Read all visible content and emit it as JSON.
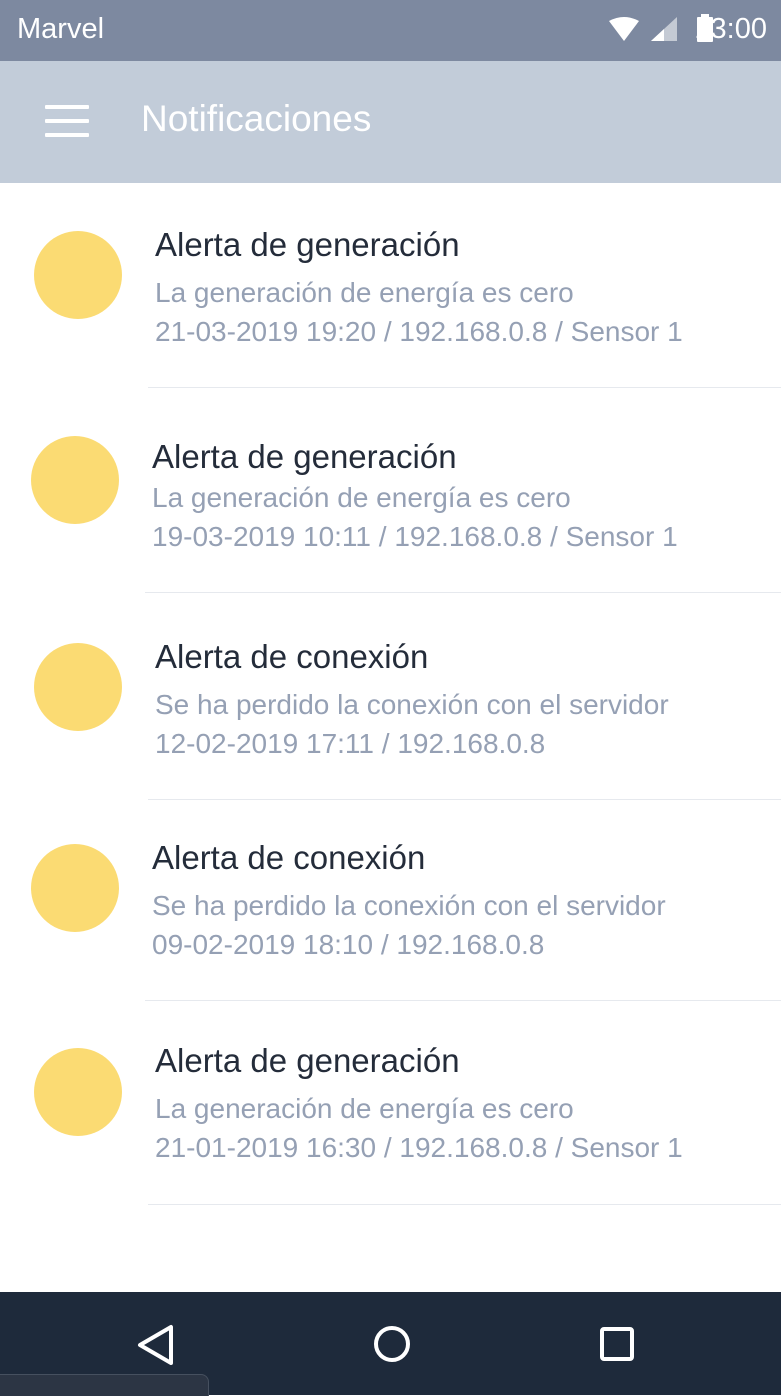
{
  "status_bar": {
    "carrier": "Marvel",
    "time": "13:00",
    "icons": [
      "wifi-icon",
      "signal-icon",
      "battery-icon"
    ]
  },
  "app_bar": {
    "menu_icon": "hamburger-menu-icon",
    "title": "Notificaciones"
  },
  "colors": {
    "status_bar": "#7d89a0",
    "app_bar": "#c2ccd9",
    "avatar": "#fbdb73",
    "title_text": "#242c3a",
    "secondary_text": "#95a0b4",
    "nav_bar": "#1e2a3b"
  },
  "notifications": [
    {
      "title": "Alerta de generación",
      "message": "La generación de energía es cero",
      "meta": "21-03-2019 19:20 / 192.168.0.8 / Sensor 1"
    },
    {
      "title": "Alerta de generación",
      "message": "La generación de energía es cero",
      "meta": "19-03-2019 10:11 / 192.168.0.8 / Sensor 1"
    },
    {
      "title": "Alerta de conexión",
      "message": "Se ha perdido la conexión con el servidor",
      "meta": "12-02-2019 17:11 / 192.168.0.8"
    },
    {
      "title": "Alerta de conexión",
      "message": "Se ha perdido la conexión con el servidor",
      "meta": "09-02-2019 18:10 / 192.168.0.8"
    },
    {
      "title": "Alerta de generación",
      "message": "La generación de energía es cero",
      "meta": "21-01-2019 16:30 / 192.168.0.8 / Sensor 1"
    }
  ],
  "nav_bar": {
    "icons": [
      "back-icon",
      "home-icon",
      "recents-icon"
    ]
  }
}
